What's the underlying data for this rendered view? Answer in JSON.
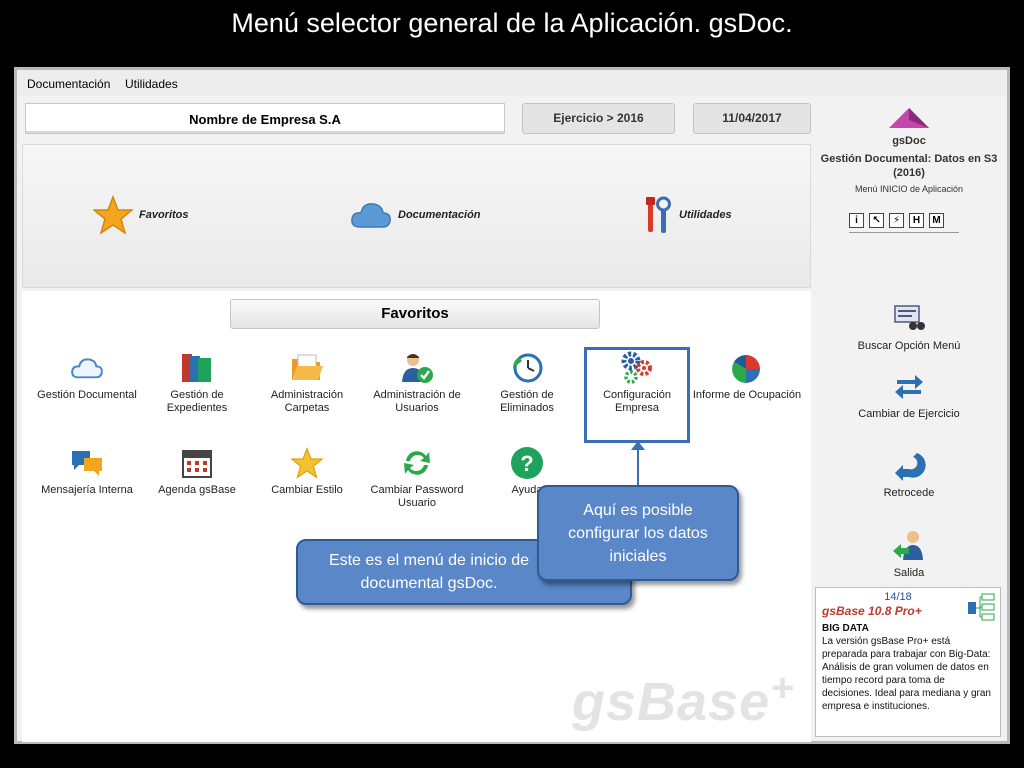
{
  "slide_title": "Menú selector general de la Aplicación. gsDoc.",
  "menubar": {
    "items": [
      "Documentación",
      "Utilidades"
    ]
  },
  "header": {
    "company": "Nombre de Empresa S.A",
    "ejercicio": "Ejercicio > 2016",
    "date": "11/04/2017"
  },
  "categories": [
    {
      "label": "Favoritos",
      "icon": "star-icon"
    },
    {
      "label": "Documentación",
      "icon": "cloud-icon"
    },
    {
      "label": "Utilidades",
      "icon": "tools-icon"
    }
  ],
  "favorites": {
    "header": "Favoritos",
    "tiles": [
      {
        "label": "Gestión Documental",
        "icon": "cloud-icon"
      },
      {
        "label": "Gestión de Expedientes",
        "icon": "folders-icon"
      },
      {
        "label": "Administración Carpetas",
        "icon": "folder-open-icon"
      },
      {
        "label": "Administración de Usuarios",
        "icon": "user-check-icon"
      },
      {
        "label": "Gestión de Eliminados",
        "icon": "clock-icon"
      },
      {
        "label": "Configuración Empresa",
        "icon": "gears-icon"
      },
      {
        "label": "Informe de Ocupación",
        "icon": "pie-chart-icon"
      },
      {
        "label": "Mensajería Interna",
        "icon": "chat-icon"
      },
      {
        "label": "Agenda gsBase",
        "icon": "calendar-icon"
      },
      {
        "label": "Cambiar Estilo",
        "icon": "star-icon"
      },
      {
        "label": "Cambiar Password Usuario",
        "icon": "refresh-icon"
      },
      {
        "label": "Ayuda",
        "icon": "help-icon"
      }
    ]
  },
  "callouts": {
    "config": "Aquí es posible configurar los datos iniciales",
    "menu_line1": "Este es el menú de inicio de",
    "menu_line2": "documental gsDoc."
  },
  "watermark": "gsBase",
  "sidebar": {
    "logo_label": "gsDoc",
    "app_title": "Gestión Documental: Datos en S3 (2016)",
    "subtitle": "Menú INICIO de Aplicación",
    "tool_buttons": [
      "i",
      "↖",
      "⚡",
      "H",
      "M"
    ],
    "buttons": [
      {
        "label": "Buscar Opción Menú",
        "icon": "search-menu-icon"
      },
      {
        "label": "Cambiar de Ejercicio",
        "icon": "swap-arrows-icon"
      },
      {
        "label": "Retrocede",
        "icon": "back-arrow-icon"
      },
      {
        "label": "Salida",
        "icon": "exit-user-icon"
      }
    ]
  },
  "info_box": {
    "counter": "14/18",
    "product": "gsBase 10.8 Pro+",
    "heading": "BIG DATA",
    "text": "La versión gsBase Pro+ está preparada para trabajar con Big-Data: Análisis de gran volumen de datos en tiempo record para toma de decisiones. Ideal para mediana y gran empresa e instituciones."
  },
  "colors": {
    "accent_blue": "#3a6fb5",
    "callout": "#5a87c8",
    "product_red": "#c0392b",
    "counter_blue": "#2a4fa0"
  }
}
